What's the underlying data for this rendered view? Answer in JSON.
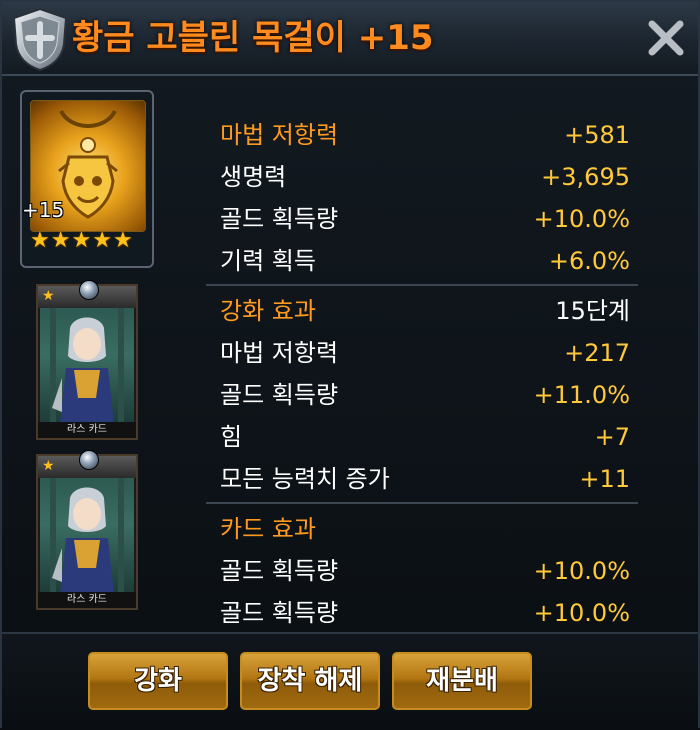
{
  "dialog": {
    "title": "황금 고블린 목걸이 +15",
    "item_level": "+15",
    "stars": 5
  },
  "cards": [
    {
      "name": "라스 카드"
    },
    {
      "name": "라스 카드"
    }
  ],
  "stats": {
    "base": [
      {
        "label": "마법 저항력",
        "value": "+581"
      },
      {
        "label": "생명력",
        "value": "+3,695"
      },
      {
        "label": "골드 획득량",
        "value": "+10.0%"
      },
      {
        "label": "기력 획득",
        "value": "+6.0%"
      }
    ],
    "enhance_header": {
      "label": "강화 효과",
      "value": "15단계"
    },
    "enhance": [
      {
        "label": "마법 저항력",
        "value": "+217"
      },
      {
        "label": "골드 획득량",
        "value": "+11.0%"
      },
      {
        "label": "힘",
        "value": "+7"
      },
      {
        "label": "모든 능력치 증가",
        "value": "+11"
      }
    ],
    "card_header": {
      "label": "카드 효과"
    },
    "card": [
      {
        "label": "골드 획득량",
        "value": "+10.0%"
      },
      {
        "label": "골드 획득량",
        "value": "+10.0%"
      }
    ]
  },
  "buttons": {
    "enhance": "강화",
    "unequip": "장착 해제",
    "redistribute": "재분배"
  },
  "colors": {
    "title": "#ff8a1e",
    "highlight_label": "#ff9a1e",
    "value": "#ffc93a",
    "button": "#b27612"
  }
}
